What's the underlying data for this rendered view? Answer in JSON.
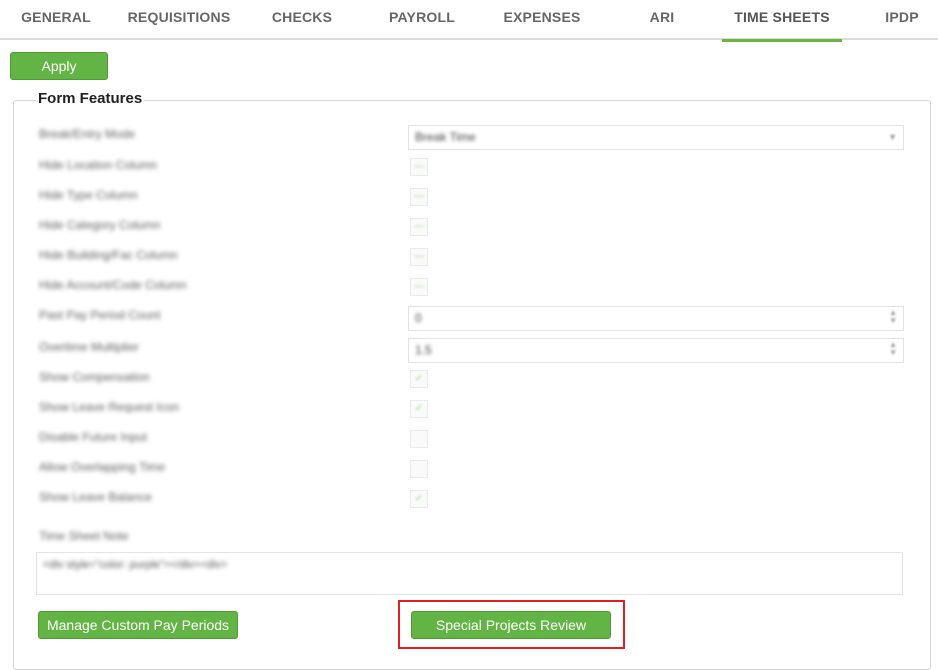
{
  "tabs": [
    {
      "label": "GENERAL"
    },
    {
      "label": "REQUISITIONS"
    },
    {
      "label": "CHECKS"
    },
    {
      "label": "PAYROLL"
    },
    {
      "label": "EXPENSES"
    },
    {
      "label": "ARI"
    },
    {
      "label": "TIME SHEETS",
      "active": true
    },
    {
      "label": "IPDP"
    }
  ],
  "toolbar": {
    "apply_label": "Apply"
  },
  "form_features": {
    "legend": "Form Features",
    "rows": [
      {
        "label": "Break/Entry Mode",
        "control": "select",
        "value": "Break Time"
      },
      {
        "label": "Hide Location Column",
        "control": "checkbox",
        "checked": false
      },
      {
        "label": "Hide Type Column",
        "control": "checkbox",
        "checked": false
      },
      {
        "label": "Hide Category Column",
        "control": "checkbox",
        "checked": false
      },
      {
        "label": "Hide Building/Fac Column",
        "control": "checkbox",
        "checked": false
      },
      {
        "label": "Hide Account/Code Column",
        "control": "checkbox",
        "checked": false
      },
      {
        "label": "Past Pay Period Count",
        "control": "number",
        "value": "0"
      },
      {
        "label": "Overtime Multiplier",
        "control": "number",
        "value": "1.5"
      },
      {
        "label": "Show Compensation",
        "control": "checkbox",
        "checked": true
      },
      {
        "label": "Show Leave Request Icon",
        "control": "checkbox",
        "checked": true
      },
      {
        "label": "Disable Future Input",
        "control": "checkbox",
        "checked": false
      },
      {
        "label": "Allow Overlapping Time",
        "control": "checkbox",
        "checked": false
      },
      {
        "label": "Show Leave Balance",
        "control": "checkbox",
        "checked": true
      }
    ],
    "note_label": "Time Sheet Note",
    "note_value": "<div style=\"color: purple\"></div><div>"
  },
  "buttons": {
    "manage_pay_periods": "Manage Custom Pay Periods",
    "special_projects": "Special Projects Review"
  },
  "colors": {
    "accent": "#62b545",
    "highlight": "#e02020"
  }
}
